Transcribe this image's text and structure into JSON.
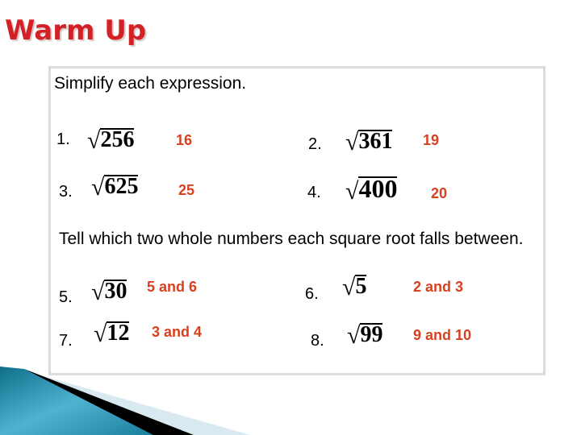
{
  "title": "Warm Up",
  "section1": {
    "instruction": "Simplify each expression.",
    "problems": [
      {
        "label": "1.",
        "radicand": "256",
        "answer": "16"
      },
      {
        "label": "2.",
        "radicand": "361",
        "answer": "19"
      },
      {
        "label": "3.",
        "radicand": "625",
        "answer": "25"
      },
      {
        "label": "4.",
        "radicand": "400",
        "answer": "20"
      }
    ]
  },
  "section2": {
    "instruction": "Tell which two whole numbers each square root falls between.",
    "problems": [
      {
        "label": "5.",
        "radicand": "30",
        "answer": "5 and 6"
      },
      {
        "label": "6.",
        "radicand": "5",
        "answer": "2 and 3"
      },
      {
        "label": "7.",
        "radicand": "12",
        "answer": "3 and 4"
      },
      {
        "label": "8.",
        "radicand": "99",
        "answer": "9 and 10"
      }
    ]
  },
  "radical_symbol": "√"
}
